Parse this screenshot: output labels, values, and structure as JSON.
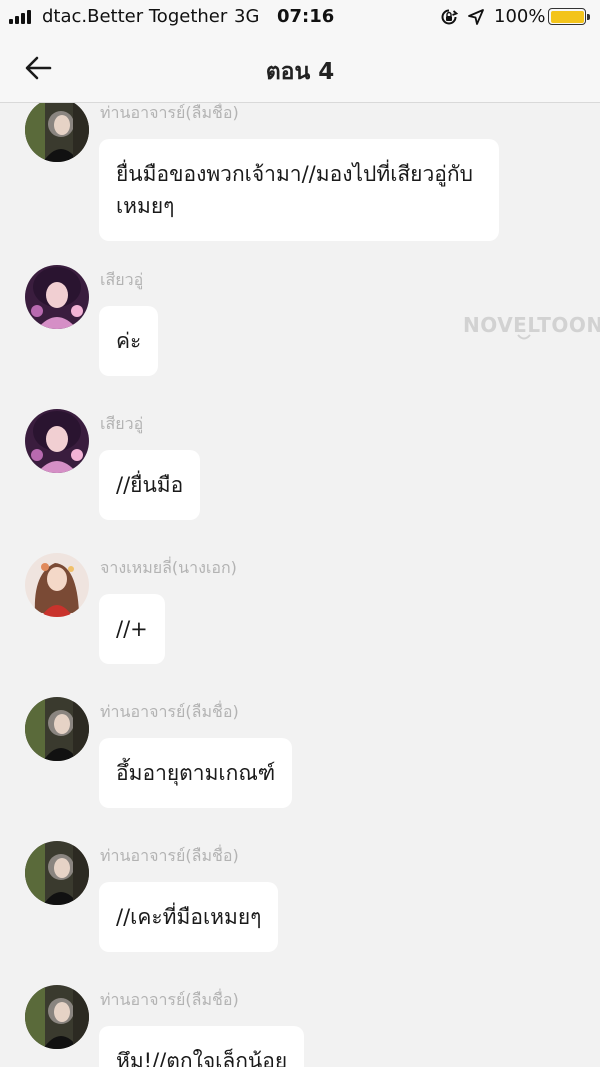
{
  "status_bar": {
    "carrier": "dtac.Better Together",
    "network": "3G",
    "time": "07:16",
    "battery_percent": "100%",
    "battery_level": 1.0,
    "battery_color": "#f3c41b",
    "icons": [
      "signal-icon",
      "orientation-lock-icon",
      "location-icon",
      "battery-icon"
    ]
  },
  "nav": {
    "title": "ตอน 4",
    "back_icon": "arrow-left-icon"
  },
  "watermark": "NOVELTOON",
  "messages": [
    {
      "sender": "ท่านอาจารย์(ลืมชื่อ)",
      "text": "ยื่นมือของพวกเจ้ามา//มองไปที่เสียวอู่กับเหมยๆ",
      "avatar": "dark-hair-avatar"
    },
    {
      "sender": "เสียวอู่",
      "text": "ค่ะ",
      "avatar": "purple-avatar"
    },
    {
      "sender": "เสียวอู่",
      "text": "//ยื่นมือ",
      "avatar": "purple-avatar"
    },
    {
      "sender": "จางเหมยลี่(นางเอก)",
      "text": "//+",
      "avatar": "red-dress-avatar"
    },
    {
      "sender": "ท่านอาจารย์(ลืมชื่อ)",
      "text": "อึ้มอายุตามเกณฑ์",
      "avatar": "dark-hair-avatar"
    },
    {
      "sender": "ท่านอาจารย์(ลืมชื่อ)",
      "text": "//เคะที่มือเหมยๆ",
      "avatar": "dark-hair-avatar"
    },
    {
      "sender": "ท่านอาจารย์(ลืมชื่อ)",
      "text": "หึม!//ตกใจเล็กน้อย",
      "avatar": "dark-hair-avatar"
    }
  ]
}
